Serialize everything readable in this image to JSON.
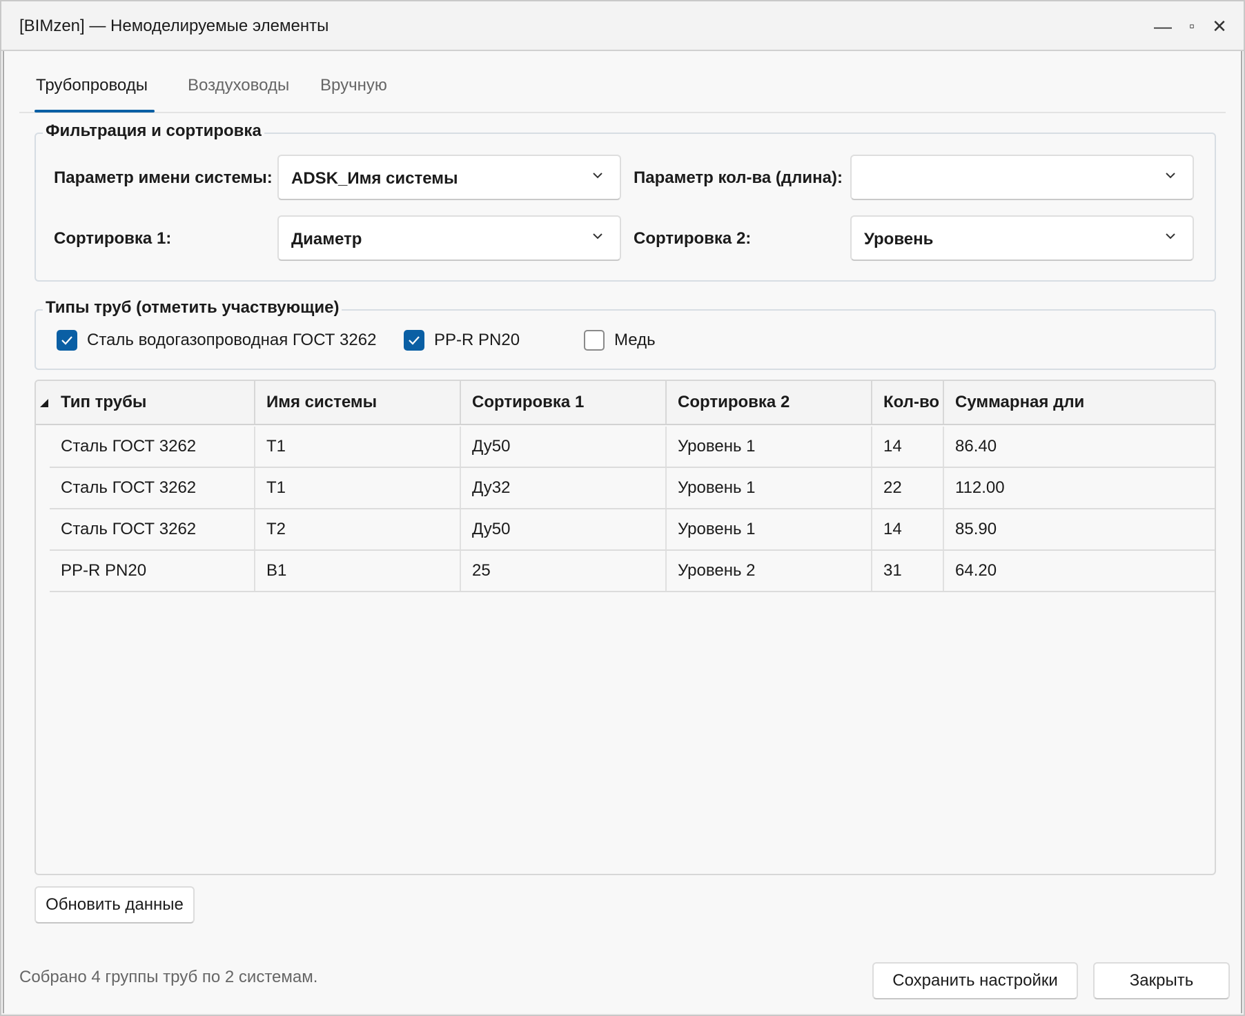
{
  "window": {
    "title": "[BIMzen] — Немоделируемые элементы",
    "controls": {
      "minimize": "—",
      "maximize": "▫",
      "close": "✕"
    }
  },
  "tabs": [
    {
      "label": "Трубопроводы",
      "active": true
    },
    {
      "label": "Воздуховоды",
      "active": false
    },
    {
      "label": "Вручную",
      "active": false
    }
  ],
  "filter": {
    "legend": "Фильтрация и сортировка",
    "system_param_label": "Параметр имени системы:",
    "system_param_value": "ADSK_Имя системы",
    "qty_param_label": "Параметр кол-ва (длина):",
    "qty_param_value": "",
    "sort1_label": "Сортировка 1:",
    "sort1_value": "Диаметр",
    "sort2_label": "Сортировка 2:",
    "sort2_value": "Уровень"
  },
  "pipe_types": {
    "legend": "Типы труб (отметить участвующие)",
    "items": [
      {
        "label": "Сталь водогазопроводная ГОСТ 3262",
        "checked": true
      },
      {
        "label": "PP-R PN20",
        "checked": true
      },
      {
        "label": "Медь",
        "checked": false
      }
    ]
  },
  "table": {
    "columns": [
      "Тип трубы",
      "Имя системы",
      "Сортировка 1",
      "Сортировка 2",
      "Кол-во",
      "Суммарная дли"
    ],
    "rows": [
      [
        "Сталь ГОСТ 3262",
        "Т1",
        "Ду50",
        "Уровень 1",
        "14",
        "86.40"
      ],
      [
        "Сталь ГОСТ 3262",
        "Т1",
        "Ду32",
        "Уровень 1",
        "22",
        "112.00"
      ],
      [
        "Сталь ГОСТ 3262",
        "Т2",
        "Ду50",
        "Уровень 1",
        "14",
        "85.90"
      ],
      [
        "PP-R PN20",
        "В1",
        "25",
        "Уровень 2",
        "31",
        "64.20"
      ]
    ]
  },
  "buttons": {
    "refresh": "Обновить данные",
    "save": "Сохранить настройки",
    "close": "Закрыть"
  },
  "status": "Собрано 4 группы труб по 2 системам.",
  "colors": {
    "accent": "#0a5fa4"
  }
}
